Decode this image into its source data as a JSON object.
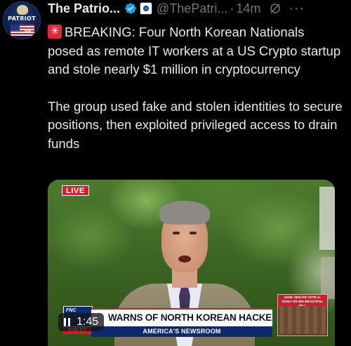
{
  "post": {
    "display_name": "The Patrio...",
    "handle": "@ThePatri...",
    "separator": "·",
    "time": "14m",
    "more": "···",
    "avatar": {
      "text_top": "PATRIOT",
      "text_bottom": "SIS"
    },
    "paragraph1": "BREAKING: Four North Korean Nationals posed as remote IT workers at a US Crypto startup and stole nearly $1 million in cryptocurrency",
    "paragraph2": "The group used fake and stolen identities to secure positions, then exploited privileged access to drain funds",
    "icons": {
      "alert": "rotating-light-emoji",
      "verified": "verified-badge-icon",
      "affiliate": "affiliate-badge-icon",
      "grok": "grok-icon",
      "more": "more-options-icon"
    },
    "colors": {
      "verified": "#1d9bf0",
      "secondary_text": "#71767b",
      "alert_red": "#e0283a"
    }
  },
  "video": {
    "live_badge": "LIVE",
    "chyron_headline": "WARNS OF NORTH KOREAN HACKER SCAM",
    "chyron_show": "AMERICA'S NEWSROOM",
    "side_box_title": "NOW: SENATE VOTE-A-RAMA ON BIG BEAUTIFUL BILL",
    "clock": "8:45 CT",
    "duration": "1:45",
    "play_state": "paused"
  }
}
